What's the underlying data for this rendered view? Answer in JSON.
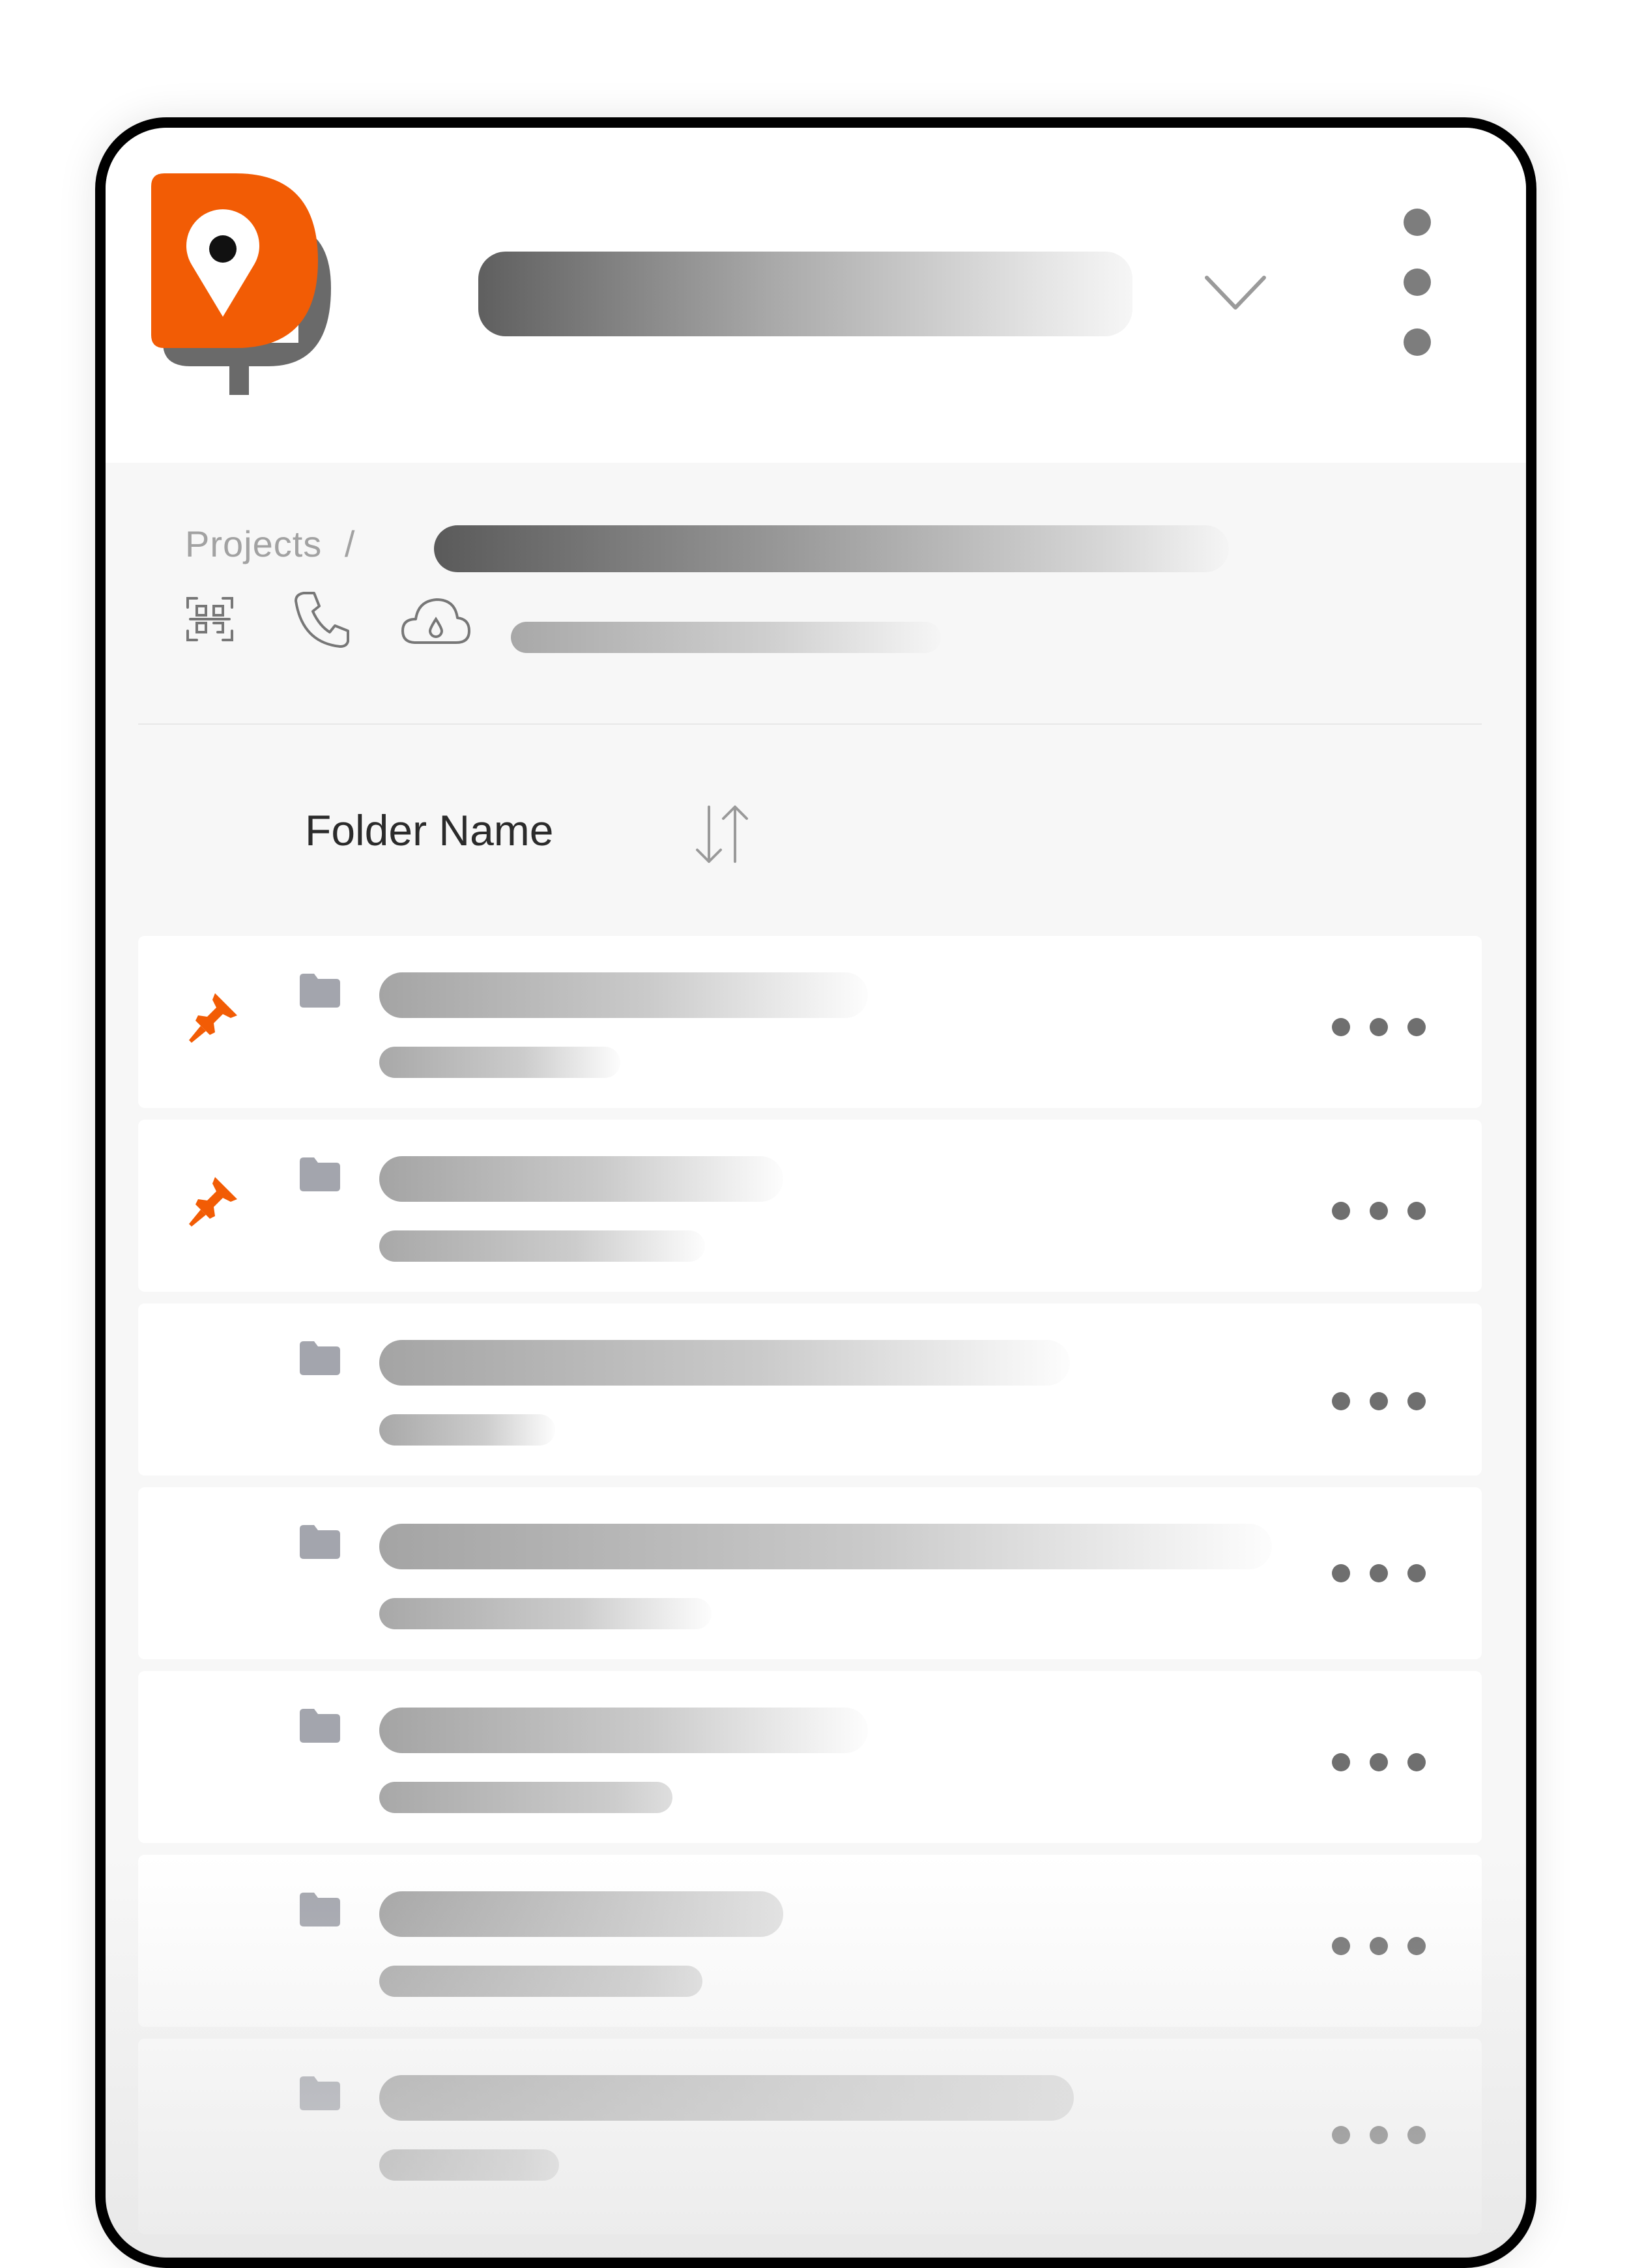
{
  "brand": {
    "accent": "#f25c05",
    "logo_icon": "location-pin-logo-icon"
  },
  "header": {
    "menu_icon": "vertical-dots-icon",
    "dropdown_icon": "chevron-down-icon"
  },
  "breadcrumb": {
    "root_label": "Projects",
    "separator": "/"
  },
  "info_bar": {
    "icons": [
      "qr-code-icon",
      "phone-icon",
      "cloud-drop-icon"
    ]
  },
  "list": {
    "column_header": "Folder Name",
    "sort_icon": "sort-arrows-icon",
    "rows": [
      {
        "pinned": true
      },
      {
        "pinned": true
      },
      {
        "pinned": false
      },
      {
        "pinned": false
      },
      {
        "pinned": false
      },
      {
        "pinned": false
      },
      {
        "pinned": false
      }
    ]
  }
}
